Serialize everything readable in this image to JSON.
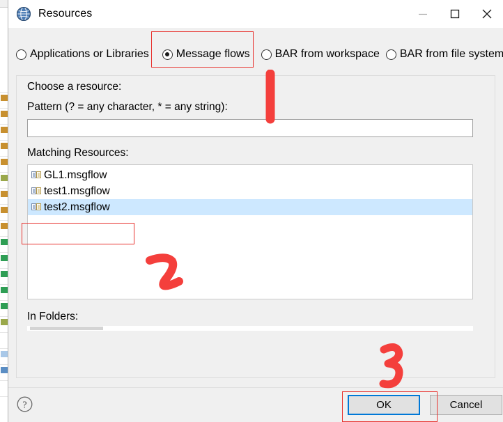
{
  "window": {
    "title": "Resources",
    "icon": "globe-icon",
    "controls": {
      "minimize": "minimize-icon",
      "maximize": "maximize-icon",
      "close": "close-icon"
    }
  },
  "resource_type_options": [
    {
      "label": "Applications or Libraries",
      "selected": false
    },
    {
      "label": "Message flows",
      "selected": true
    },
    {
      "label": "BAR from workspace",
      "selected": false
    },
    {
      "label": "BAR from file system",
      "selected": false
    }
  ],
  "form": {
    "choose_label": "Choose a resource:",
    "pattern_label": "Pattern (? = any character, * = any string):",
    "pattern_value": "",
    "pattern_placeholder": "",
    "matching_label": "Matching Resources:",
    "folders_label": "In Folders:"
  },
  "matching_resources": [
    {
      "name": "GL1.msgflow",
      "icon": "msgflow-icon",
      "selected": false
    },
    {
      "name": "test1.msgflow",
      "icon": "msgflow-icon",
      "selected": false
    },
    {
      "name": "test2.msgflow",
      "icon": "msgflow-icon",
      "selected": true
    }
  ],
  "buttons": {
    "help": "?",
    "ok": "OK",
    "cancel": "Cancel"
  },
  "annotations": {
    "color": "#e8332f",
    "marks": [
      {
        "id": "1",
        "label": "1",
        "target": "message-flows-radio"
      },
      {
        "id": "2",
        "label": "2",
        "target": "test2-msgflow-item"
      },
      {
        "id": "3",
        "label": "3",
        "target": "ok-button"
      }
    ]
  },
  "colors": {
    "dialog_background": "#f0f0f0",
    "titlebar_background": "#ffffff",
    "selection_blue": "#cde8ff",
    "focus_blue": "#0078d7",
    "annotation_red": "#e8332f"
  }
}
